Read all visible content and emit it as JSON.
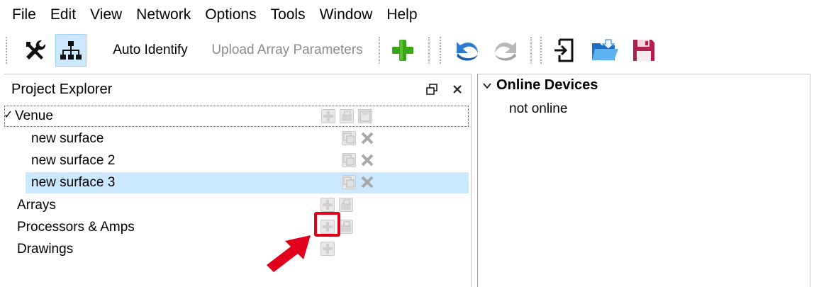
{
  "menu": [
    "File",
    "Edit",
    "View",
    "Network",
    "Options",
    "Tools",
    "Window",
    "Help"
  ],
  "toolbar": {
    "settings_icon": "wrench-screwdriver-icon",
    "network_icon": "network-tree-icon",
    "auto_identify": "Auto Identify",
    "upload_array": "Upload Array Parameters",
    "add_icon": "green-plus-icon",
    "undo_icon": "undo-icon",
    "redo_icon": "redo-icon",
    "import_icon": "import-icon",
    "open_icon": "open-folder-icon",
    "save_icon": "save-icon",
    "colors": {
      "selected_bg": "#cde8ff",
      "plus_green": "#3aa617",
      "save_color": "#b0214f"
    }
  },
  "project_explorer": {
    "title": "Project Explorer",
    "tree": {
      "venue": "Venue",
      "surfaces": [
        "new surface",
        "new surface 2",
        "new surface 3"
      ],
      "arrays": "Arrays",
      "processors": "Processors & Amps",
      "drawings": "Drawings"
    }
  },
  "online_devices": {
    "title": "Online Devices",
    "status": "not online"
  },
  "annotation": {
    "color": "#e0001b"
  }
}
